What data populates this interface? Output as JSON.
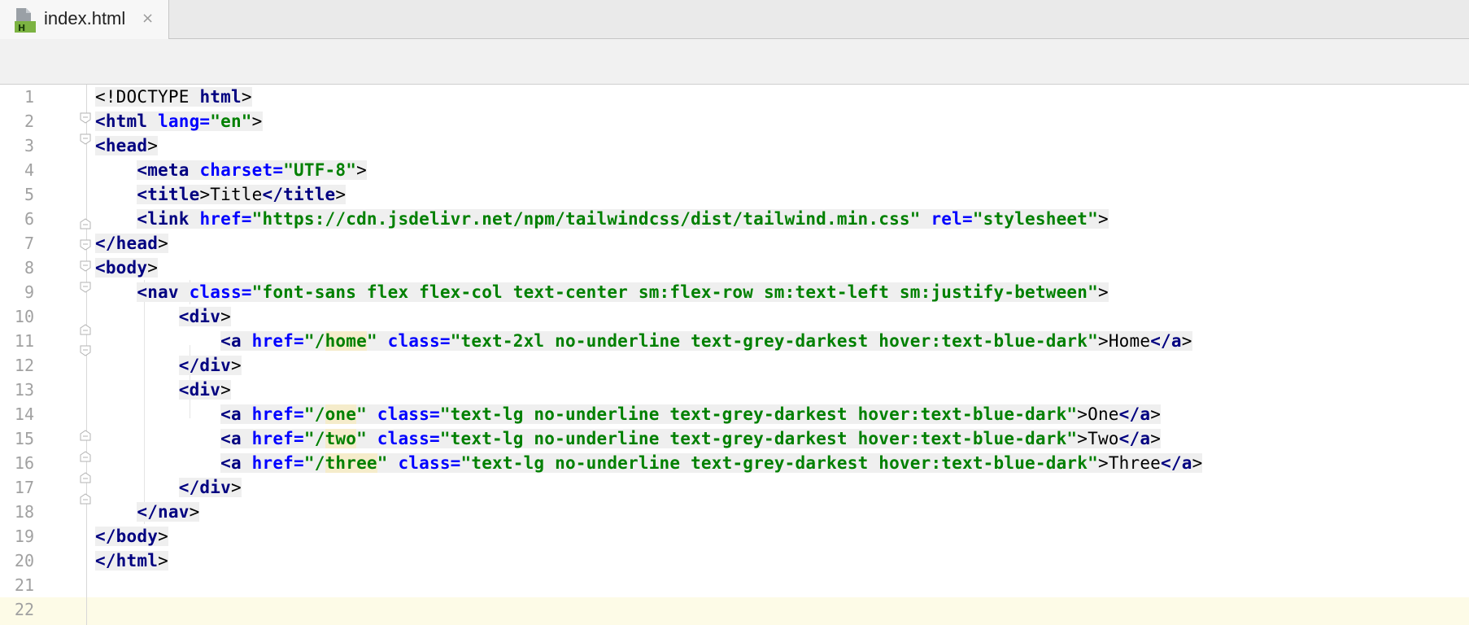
{
  "tab": {
    "label": "index.html",
    "icon": "html-file-icon",
    "close_symbol": "×"
  },
  "colors": {
    "tag": "#000080",
    "attribute": "#0000ff",
    "string": "#008000",
    "line_number": "#a1a1a1",
    "current_line": "#fdfbe7"
  },
  "line_numbers": [
    "1",
    "2",
    "3",
    "4",
    "5",
    "6",
    "7",
    "8",
    "9",
    "10",
    "11",
    "12",
    "13",
    "14",
    "15",
    "16",
    "17",
    "18",
    "19",
    "20",
    "21",
    "22"
  ],
  "code": {
    "l1": [
      "<!DOCTYPE",
      "html",
      ">"
    ],
    "l2": [
      "<html",
      "lang=",
      "\"en\"",
      ">"
    ],
    "l3": [
      "<head",
      ">"
    ],
    "l4": [
      "<meta",
      "charset=",
      "\"UTF-8\"",
      ">"
    ],
    "l5": [
      "<title",
      ">",
      "Title",
      "</title",
      ">"
    ],
    "l6": [
      "<link",
      "href=",
      "\"https://cdn.jsdelivr.net/npm/tailwindcss/dist/tailwind.min.css\"",
      "rel=",
      "\"stylesheet\"",
      ">"
    ],
    "l7": [
      "</head",
      ">"
    ],
    "l8": [
      "<body",
      ">"
    ],
    "l9": [
      "<nav",
      "class=",
      "\"font-sans flex flex-col text-center sm:flex-row sm:text-left sm:justify-between\"",
      ">"
    ],
    "l10": [
      "<div",
      ">"
    ],
    "l11": [
      "<a",
      "href=",
      "\"/",
      "home",
      "\"",
      "class=",
      "\"text-2xl no-underline text-grey-darkest hover:text-blue-dark\"",
      ">",
      "Home",
      "</a",
      ">"
    ],
    "l12": [
      "</div",
      ">"
    ],
    "l13": [
      "<div",
      ">"
    ],
    "l14": [
      "<a",
      "href=",
      "\"/",
      "one",
      "\"",
      "class=",
      "\"text-lg no-underline text-grey-darkest hover:text-blue-dark\"",
      ">",
      "One",
      "</a",
      ">"
    ],
    "l15": [
      "<a",
      "href=",
      "\"/",
      "two",
      "\"",
      "class=",
      "\"text-lg no-underline text-grey-darkest hover:text-blue-dark\"",
      ">",
      "Two",
      "</a",
      ">"
    ],
    "l16": [
      "<a",
      "href=",
      "\"/",
      "three",
      "\"",
      "class=",
      "\"text-lg no-underline text-grey-darkest hover:text-blue-dark\"",
      ">",
      "Three",
      "</a",
      ">"
    ],
    "l17": [
      "</div",
      ">"
    ],
    "l18": [
      "</nav",
      ">"
    ],
    "l19": [
      "</body",
      ">"
    ],
    "l20": [
      "</html",
      ">"
    ]
  }
}
